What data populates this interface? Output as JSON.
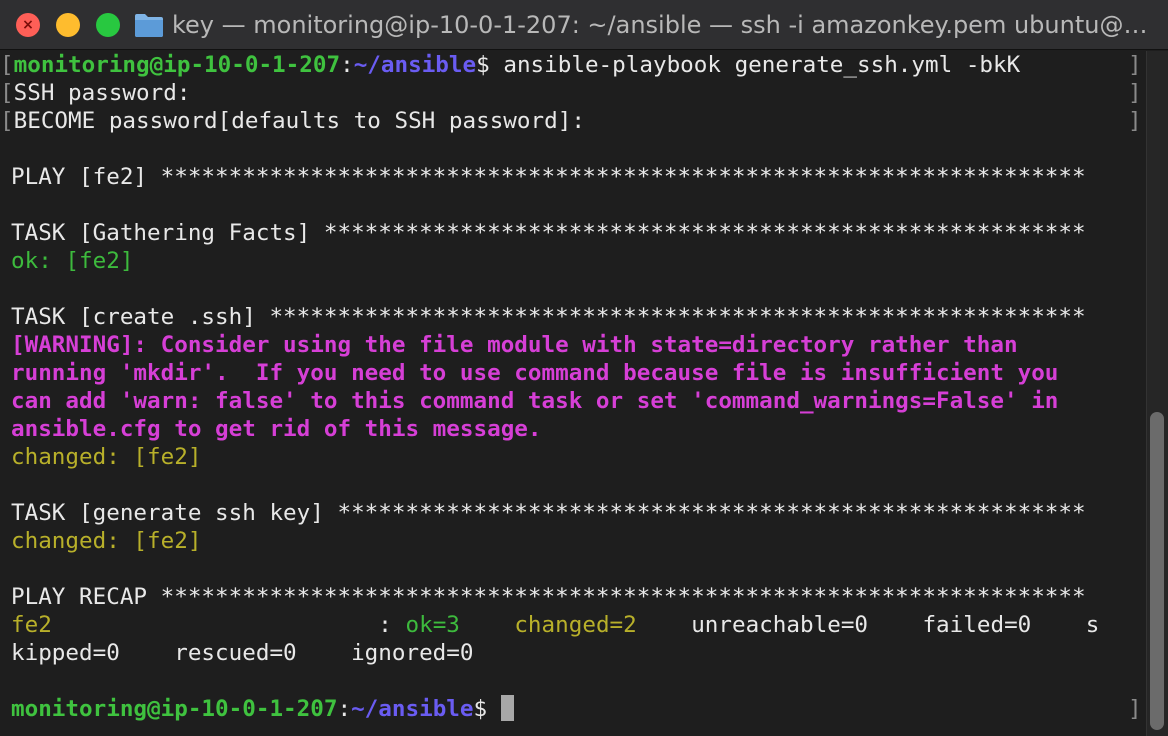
{
  "window": {
    "title": "key — monitoring@ip-10-0-1-207: ~/ansible — ssh -i amazonkey.pem ubuntu@5..."
  },
  "colors": {
    "background": "#1e1e1e",
    "prompt_user": "#3fc23f",
    "prompt_path": "#6a5cf2",
    "ok": "#3dba3d",
    "changed": "#b8b02a",
    "warning": "#d63fd6",
    "text": "#e8e8e8"
  },
  "terminal": {
    "prompt1": {
      "user_host": "monitoring@ip-10-0-1-207",
      "colon": ":",
      "path": "~/ansible",
      "dollar": "$",
      "command": " ansible-playbook generate_ssh.yml -bkK"
    },
    "ssh_password": "SSH password:",
    "become_password": "BECOME password[defaults to SSH password]:",
    "play_header": "PLAY [fe2] ********************************************************************",
    "task_gathering": "TASK [Gathering Facts] ********************************************************",
    "ok_fe2": "ok: [fe2]",
    "task_create_ssh": "TASK [create .ssh] ************************************************************",
    "warning_lines": [
      "[WARNING]: Consider using the file module with state=directory rather than",
      "running 'mkdir'.  If you need to use command because file is insufficient you",
      "can add 'warn: false' to this command task or set 'command_warnings=False' in",
      "ansible.cfg to get rid of this message."
    ],
    "changed_fe2_1": "changed: [fe2]",
    "task_generate_key": "TASK [generate ssh key] *******************************************************",
    "changed_fe2_2": "changed: [fe2]",
    "play_recap": "PLAY RECAP ********************************************************************",
    "recap": {
      "host": "fe2",
      "sep": "                        : ",
      "ok": "ok=3",
      "gap1": "    ",
      "changed": "changed=2",
      "gap2": "    ",
      "unreachable": "unreachable=0",
      "gap3": "    ",
      "failed": "failed=0",
      "gap4": "    ",
      "skipped_start": "s",
      "line2": "kipped=0    rescued=0    ignored=0"
    },
    "prompt2": {
      "user_host": "monitoring@ip-10-0-1-207",
      "colon": ":",
      "path": "~/ansible",
      "dollar": "$",
      "trailing": " "
    },
    "bracket_left": "[",
    "bracket_right": "]"
  }
}
